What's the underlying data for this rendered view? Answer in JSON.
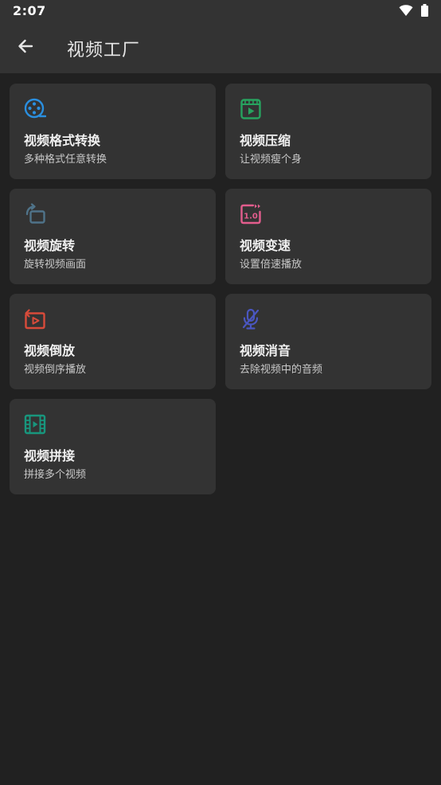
{
  "status_bar": {
    "time": "2:07",
    "icons": [
      "wifi-icon",
      "battery-icon"
    ]
  },
  "app_bar": {
    "back_icon": "arrow-left-icon",
    "title": "视频工厂"
  },
  "colors": {
    "format_convert": "#2a8fe0",
    "compress": "#27a35f",
    "rotate": "#4f7389",
    "speed": "#e35d8d",
    "reverse": "#d84b3a",
    "mute": "#4a56c0",
    "concat": "#18967d"
  },
  "cards": [
    {
      "icon": "film-reel-icon",
      "title": "视频格式转换",
      "subtitle": "多种格式任意转换"
    },
    {
      "icon": "video-compress-icon",
      "title": "视频压缩",
      "subtitle": "让视频瘦个身"
    },
    {
      "icon": "rotate-icon",
      "title": "视频旋转",
      "subtitle": "旋转视频画面"
    },
    {
      "icon": "speed-icon",
      "title": "视频变速",
      "subtitle": "设置倍速播放",
      "icon_text": "1.0"
    },
    {
      "icon": "reverse-play-icon",
      "title": "视频倒放",
      "subtitle": "视频倒序播放"
    },
    {
      "icon": "mic-off-icon",
      "title": "视频消音",
      "subtitle": "去除视频中的音频"
    },
    {
      "icon": "film-strip-icon",
      "title": "视频拼接",
      "subtitle": "拼接多个视频"
    }
  ]
}
